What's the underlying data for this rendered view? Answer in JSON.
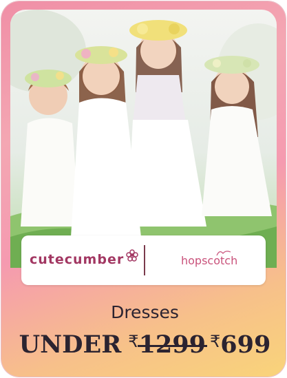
{
  "card": {
    "brand_primary": "cutecumber",
    "brand_secondary": "hopscotch",
    "category": "Dresses",
    "offer_prefix": "UNDER",
    "currency": "₹",
    "original_price": "1299",
    "offer_price": "699"
  },
  "colors": {
    "brand_cutecumber": "#a23762",
    "brand_hopscotch": "#c9527b",
    "text_dark": "#2b2330",
    "gradient_pink": "#f08fa6",
    "gradient_yellow": "#f9d47a"
  },
  "icons": {
    "flower": "flower-icon"
  }
}
